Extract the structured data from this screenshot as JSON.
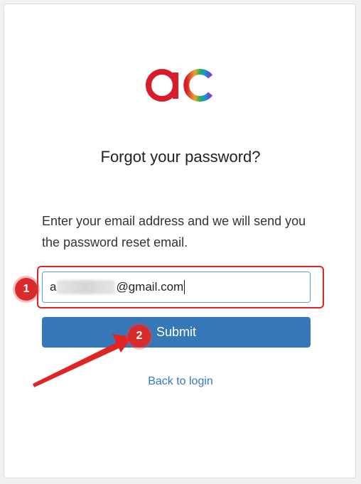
{
  "page": {
    "title": "Forgot your password?",
    "description": "Enter your email address and we will send you the password reset email."
  },
  "form": {
    "email_prefix": "a",
    "email_suffix": "@gmail.com",
    "submit_label": "Submit"
  },
  "links": {
    "back_to_login": "Back to login"
  },
  "annotations": {
    "step1": "1",
    "step2": "2",
    "color": "#d92b2b"
  },
  "logo": {
    "icon": "ac-logo",
    "gradient": [
      "#d91c2b",
      "#e5473a",
      "#f0a22e",
      "#2fb34a",
      "#1a8fd8",
      "#7c3fc1"
    ]
  }
}
